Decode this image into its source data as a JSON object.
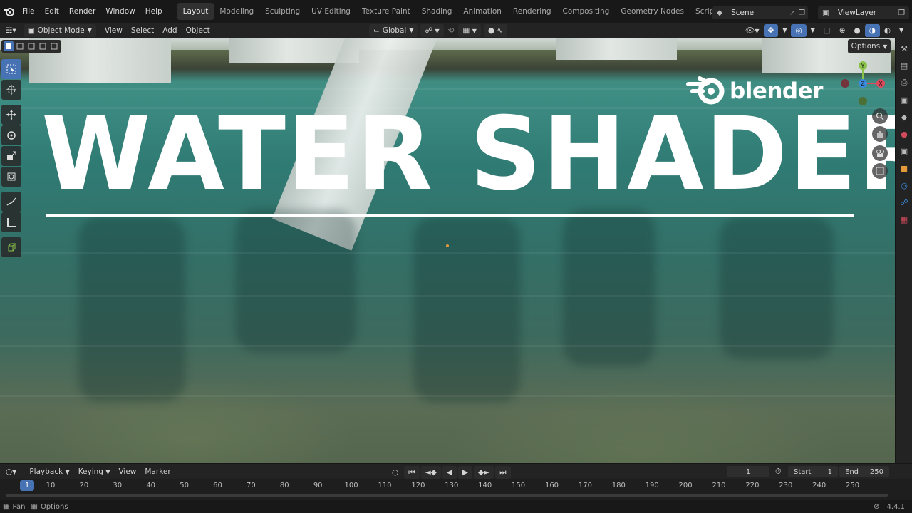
{
  "menu": [
    "File",
    "Edit",
    "Render",
    "Window",
    "Help"
  ],
  "workspaces": [
    {
      "label": "Layout",
      "active": true
    },
    {
      "label": "Modeling",
      "active": false
    },
    {
      "label": "Sculpting",
      "active": false
    },
    {
      "label": "UV Editing",
      "active": false
    },
    {
      "label": "Texture Paint",
      "active": false
    },
    {
      "label": "Shading",
      "active": false
    },
    {
      "label": "Animation",
      "active": false
    },
    {
      "label": "Rendering",
      "active": false
    },
    {
      "label": "Compositing",
      "active": false
    },
    {
      "label": "Geometry Nodes",
      "active": false
    },
    {
      "label": "Scripting",
      "active": false
    }
  ],
  "workspace_add": "+",
  "scene": {
    "label": "Scene",
    "view_layer": "ViewLayer"
  },
  "header": {
    "mode": "Object Mode",
    "view": "View",
    "select": "Select",
    "add": "Add",
    "object": "Object",
    "orientation": "Global",
    "options": "Options"
  },
  "overlay": {
    "title": "WATER SHADER",
    "brand": "blender"
  },
  "gizmo": {
    "x": "X",
    "y": "Y",
    "z": "Z"
  },
  "timeline": {
    "playback": "Playback",
    "keying": "Keying",
    "view": "View",
    "marker": "Marker",
    "current_frame": "1",
    "start_label": "Start",
    "start_value": "1",
    "end_label": "End",
    "end_value": "250",
    "ticks": [
      "1",
      "10",
      "20",
      "30",
      "40",
      "50",
      "60",
      "70",
      "80",
      "90",
      "100",
      "110",
      "120",
      "130",
      "140",
      "150",
      "160",
      "170",
      "180",
      "190",
      "200",
      "210",
      "220",
      "230",
      "240",
      "250"
    ]
  },
  "status": {
    "pan": "Pan",
    "options": "Options",
    "version": "4.4.1"
  },
  "colors": {
    "accent": "#4772b3",
    "x_axis": "#e0495b",
    "y_axis": "#8bc34a",
    "z_axis": "#3b8ce0"
  }
}
